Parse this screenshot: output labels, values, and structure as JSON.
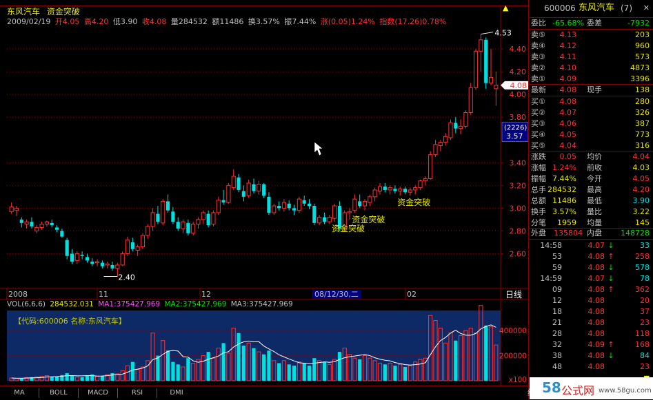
{
  "colors": {
    "up": "#ff3232",
    "down": "#00e0e0",
    "yellow": "#e6e600",
    "white": "#ffffff",
    "gray": "#c0c0c0",
    "magenta": "#ff50ff",
    "green": "#00e000",
    "navy": "#000080",
    "grid": "#8a0000",
    "volbg": "#0e2a66"
  },
  "header": {
    "stock_name": "东风汽车",
    "formula": "资金突破"
  },
  "info": {
    "date": "2009/02/19",
    "open": "开4.05",
    "high": "高4.20",
    "low": "低3.90",
    "close": "收4.08",
    "volume": "量284532",
    "amount": "额11486",
    "turnover": "换3.57%",
    "amplitude": "振7.44%",
    "change": "涨(0.05)1.24%",
    "index": "指数(17.26)0.78%"
  },
  "chart_data": {
    "type": "candlestick",
    "ylim": [
      2.3,
      4.6
    ],
    "y_ticks": [
      "4.40",
      "4.20",
      "4.00",
      "3.80",
      "3.40",
      "3.20",
      "3.00",
      "2.80",
      "2.60"
    ],
    "x_tick_labels": [
      "2008",
      "11",
      "12",
      "08/12/30,二",
      "02"
    ],
    "period_label": "日线",
    "current_price_tag": "4.08",
    "cursor_box": {
      "top": "(2226)",
      "bottom": "3.57"
    },
    "annotations": {
      "high": "4.53",
      "low": "2.40",
      "signal": "资金突破"
    },
    "candles": [
      [
        2.97,
        3.05,
        2.95,
        3.01
      ],
      [
        2.98,
        3.02,
        2.93,
        3.0
      ],
      [
        2.9,
        2.92,
        2.83,
        2.87
      ],
      [
        2.86,
        2.9,
        2.82,
        2.88
      ],
      [
        2.88,
        2.92,
        2.82,
        2.84
      ],
      [
        2.8,
        2.85,
        2.78,
        2.83
      ],
      [
        2.83,
        2.88,
        2.81,
        2.86
      ],
      [
        2.86,
        2.89,
        2.84,
        2.88
      ],
      [
        2.87,
        2.9,
        2.83,
        2.85
      ],
      [
        2.83,
        2.85,
        2.79,
        2.81
      ],
      [
        2.8,
        2.82,
        2.74,
        2.75
      ],
      [
        2.72,
        2.74,
        2.55,
        2.58
      ],
      [
        2.6,
        2.64,
        2.51,
        2.53
      ],
      [
        2.54,
        2.62,
        2.51,
        2.6
      ],
      [
        2.59,
        2.62,
        2.55,
        2.58
      ],
      [
        2.57,
        2.6,
        2.52,
        2.54
      ],
      [
        2.53,
        2.56,
        2.49,
        2.51
      ],
      [
        2.52,
        2.55,
        2.49,
        2.53
      ],
      [
        2.52,
        2.54,
        2.47,
        2.49
      ],
      [
        2.5,
        2.53,
        2.47,
        2.51
      ],
      [
        2.5,
        2.53,
        2.45,
        2.47
      ],
      [
        2.47,
        2.52,
        2.4,
        2.5
      ],
      [
        2.5,
        2.62,
        2.49,
        2.6
      ],
      [
        2.6,
        2.75,
        2.58,
        2.72
      ],
      [
        2.7,
        2.74,
        2.62,
        2.64
      ],
      [
        2.63,
        2.68,
        2.58,
        2.66
      ],
      [
        2.66,
        2.78,
        2.64,
        2.76
      ],
      [
        2.76,
        2.86,
        2.73,
        2.84
      ],
      [
        2.84,
        3.0,
        2.8,
        2.96
      ],
      [
        2.95,
        3.02,
        2.86,
        2.88
      ],
      [
        2.87,
        3.08,
        2.85,
        3.06
      ],
      [
        3.06,
        3.12,
        2.96,
        2.98
      ],
      [
        2.97,
        3.01,
        2.86,
        2.88
      ],
      [
        2.88,
        2.92,
        2.8,
        2.82
      ],
      [
        2.82,
        2.9,
        2.78,
        2.88
      ],
      [
        2.87,
        2.9,
        2.76,
        2.78
      ],
      [
        2.78,
        2.88,
        2.76,
        2.86
      ],
      [
        2.86,
        2.92,
        2.82,
        2.9
      ],
      [
        2.9,
        2.98,
        2.86,
        2.96
      ],
      [
        2.95,
        2.98,
        2.83,
        2.85
      ],
      [
        2.86,
        2.98,
        2.84,
        2.96
      ],
      [
        2.96,
        3.1,
        2.94,
        3.07
      ],
      [
        3.07,
        3.16,
        3.03,
        3.05
      ],
      [
        3.05,
        3.22,
        3.04,
        3.2
      ],
      [
        3.18,
        3.34,
        3.16,
        3.28
      ],
      [
        3.27,
        3.3,
        3.14,
        3.16
      ],
      [
        3.15,
        3.2,
        3.06,
        3.1
      ],
      [
        3.11,
        3.25,
        3.09,
        3.22
      ],
      [
        3.21,
        3.26,
        3.13,
        3.15
      ],
      [
        3.15,
        3.24,
        3.12,
        3.21
      ],
      [
        3.21,
        3.22,
        3.09,
        3.11
      ],
      [
        3.1,
        3.14,
        2.94,
        2.96
      ],
      [
        2.96,
        3.04,
        2.94,
        3.02
      ],
      [
        3.02,
        3.06,
        2.98,
        3.0
      ],
      [
        3.0,
        3.08,
        2.97,
        3.05
      ],
      [
        3.04,
        3.07,
        2.98,
        3.0
      ],
      [
        3.0,
        3.03,
        2.94,
        2.98
      ],
      [
        2.98,
        3.1,
        2.96,
        3.08
      ],
      [
        3.07,
        3.11,
        3.02,
        3.04
      ],
      [
        3.04,
        3.08,
        2.99,
        3.02
      ],
      [
        3.02,
        3.04,
        2.85,
        2.87
      ],
      [
        2.87,
        2.94,
        2.85,
        2.92
      ],
      [
        2.92,
        2.96,
        2.86,
        2.88
      ],
      [
        2.88,
        2.94,
        2.86,
        2.92
      ],
      [
        2.91,
        3.04,
        2.88,
        3.02
      ],
      [
        3.02,
        3.06,
        2.8,
        2.82
      ],
      [
        2.82,
        2.98,
        2.8,
        2.96
      ],
      [
        2.96,
        3.0,
        2.9,
        2.97
      ],
      [
        2.98,
        3.12,
        2.96,
        3.08
      ],
      [
        3.06,
        3.12,
        3.0,
        3.02
      ],
      [
        3.02,
        3.08,
        2.98,
        3.06
      ],
      [
        3.05,
        3.12,
        3.02,
        3.1
      ],
      [
        3.1,
        3.18,
        3.06,
        3.16
      ],
      [
        3.15,
        3.22,
        3.12,
        3.19
      ],
      [
        3.19,
        3.22,
        3.14,
        3.16
      ],
      [
        3.16,
        3.2,
        3.12,
        3.18
      ],
      [
        3.17,
        3.2,
        3.13,
        3.15
      ],
      [
        3.15,
        3.19,
        3.11,
        3.17
      ],
      [
        3.17,
        3.19,
        3.12,
        3.14
      ],
      [
        3.14,
        3.18,
        3.11,
        3.16
      ],
      [
        3.16,
        3.2,
        3.12,
        3.18
      ],
      [
        3.18,
        3.25,
        3.16,
        3.24
      ],
      [
        3.24,
        3.28,
        3.2,
        3.26
      ],
      [
        3.26,
        3.5,
        3.25,
        3.47
      ],
      [
        3.47,
        3.6,
        3.45,
        3.56
      ],
      [
        3.55,
        3.6,
        3.5,
        3.58
      ],
      [
        3.58,
        3.66,
        3.55,
        3.63
      ],
      [
        3.62,
        3.78,
        3.6,
        3.75
      ],
      [
        3.75,
        3.8,
        3.66,
        3.7
      ],
      [
        3.7,
        3.78,
        3.65,
        3.72
      ],
      [
        3.72,
        3.86,
        3.7,
        3.84
      ],
      [
        3.84,
        4.1,
        3.82,
        4.06
      ],
      [
        4.06,
        4.4,
        4.04,
        4.38
      ],
      [
        4.38,
        4.53,
        4.2,
        4.48
      ],
      [
        4.48,
        4.5,
        4.05,
        4.1
      ],
      [
        4.1,
        4.4,
        4.08,
        4.15
      ],
      [
        4.05,
        4.2,
        3.9,
        4.08
      ]
    ],
    "volume": {
      "ylim": [
        0,
        560000
      ],
      "y_ticks": [
        "400000",
        "200000"
      ],
      "unit_label": "x100",
      "values": [
        22000,
        18000,
        20000,
        25000,
        28000,
        30000,
        35000,
        40000,
        30000,
        33000,
        45000,
        60000,
        38000,
        30000,
        28000,
        42000,
        50000,
        35000,
        40000,
        48000,
        60000,
        55000,
        80000,
        120000,
        150000,
        90000,
        110000,
        160000,
        380000,
        200000,
        320000,
        240000,
        150000,
        130000,
        110000,
        180000,
        140000,
        170000,
        200000,
        230000,
        180000,
        260000,
        300000,
        220000,
        420000,
        380000,
        280000,
        300000,
        260000,
        230000,
        210000,
        240000,
        160000,
        140000,
        160000,
        130000,
        120000,
        150000,
        140000,
        120000,
        180000,
        160000,
        150000,
        130000,
        170000,
        230000,
        260000,
        210000,
        180000,
        170000,
        200000,
        180000,
        160000,
        140000,
        130000,
        140000,
        120000,
        130000,
        110000,
        120000,
        150000,
        170000,
        180000,
        520000,
        480000,
        420000,
        300000,
        380000,
        320000,
        360000,
        400000,
        420000,
        380000,
        600000,
        440000,
        430000,
        284532
      ]
    }
  },
  "vol_legend": {
    "name": "VOL(6,6,6)",
    "value": "284532.031",
    "ma1": "MA1:375427.969",
    "ma2": "MA2:375427.969",
    "ma3": "MA3:375427.969"
  },
  "vol_caption": "【代码:600006 名称:东风汽车】",
  "tabs": [
    "MA",
    "BOLL",
    "MACD",
    "RSI",
    "DMI"
  ],
  "quote": {
    "code": "600006",
    "name": "东风汽车",
    "suffix": "(7)",
    "weibi_label": "委比",
    "weibi_value": "-65.68%",
    "weicha_label": "委差",
    "weicha_value": "-7932",
    "sells": [
      {
        "label": "卖⑤",
        "price": "4.13",
        "vol": "203"
      },
      {
        "label": "卖④",
        "price": "4.12",
        "vol": "960"
      },
      {
        "label": "卖③",
        "price": "4.11",
        "vol": "573"
      },
      {
        "label": "卖②",
        "price": "4.10",
        "vol": "4873"
      },
      {
        "label": "卖①",
        "price": "4.09",
        "vol": "3396"
      }
    ],
    "latest_label": "最新",
    "latest_value": "4.08",
    "xianshou_label": "现手",
    "xianshou_value": "138",
    "buys": [
      {
        "label": "买①",
        "price": "4.08",
        "vol": "280"
      },
      {
        "label": "买②",
        "price": "4.07",
        "vol": "326"
      },
      {
        "label": "买③",
        "price": "4.06",
        "vol": "387"
      },
      {
        "label": "买④",
        "price": "4.05",
        "vol": "773"
      },
      {
        "label": "买⑤",
        "price": "4.04",
        "vol": "316"
      }
    ],
    "stats": [
      {
        "l1": "涨跌",
        "v1": "0.05",
        "l2": "均价",
        "v2": "4.04"
      },
      {
        "l1": "涨幅",
        "v1": "1.24%",
        "l2": "前收",
        "v2": "4.03"
      },
      {
        "l1": "振幅",
        "v1": "7.44%",
        "l2": "今开",
        "v2": "4.05"
      },
      {
        "l1": "总手",
        "v1": "284532",
        "l2": "最高",
        "v2": "4.20"
      },
      {
        "l1": "总额",
        "v1": "11486",
        "l2": "最低",
        "v2": "3.90"
      },
      {
        "l1": "换手",
        "v1": "3.57%",
        "l2": "量比",
        "v2": "3.22"
      },
      {
        "l1": "分笔",
        "v1": "1959",
        "l2": "均量",
        "v2": "145"
      }
    ],
    "waipan_label": "外盘",
    "waipan_value": "135804",
    "neipan_label": "内盘",
    "neipan_value": "148728",
    "ticks": [
      {
        "time": "14:58",
        "price": "4.07",
        "arrow": "↓",
        "vol": "33"
      },
      {
        "time": "53",
        "price": "4.08",
        "arrow": "↑",
        "vol": "258"
      },
      {
        "time": "59",
        "price": "4.08",
        "arrow": "↓",
        "vol": "578"
      },
      {
        "time": "14:59",
        "price": "4.07",
        "arrow": "↓",
        "vol": "78"
      },
      {
        "time": "09",
        "price": "4.08",
        "arrow": "↑",
        "vol": "362"
      },
      {
        "time": "12",
        "price": "4.08",
        "arrow": "",
        "vol": "20"
      },
      {
        "time": "18",
        "price": "4.08",
        "arrow": "",
        "vol": "37"
      },
      {
        "time": "21",
        "price": "4.08",
        "arrow": "",
        "vol": "23"
      },
      {
        "time": "28",
        "price": "4.08",
        "arrow": "",
        "vol": "118"
      },
      {
        "time": "32",
        "price": "4.09",
        "arrow": "↑",
        "vol": "168"
      },
      {
        "time": "38",
        "price": "4.08",
        "arrow": "↓",
        "vol": "84"
      },
      {
        "time": "48",
        "price": "4.08",
        "arrow": "",
        "vol": "23"
      }
    ],
    "scroll_up_icon": "▲",
    "scroll_down_icon": "▼",
    "x_icon": "✕",
    "bottom_char": "细"
  },
  "watermark": {
    "number": "58",
    "text": "公式网",
    "url": "www.58gu.com"
  }
}
